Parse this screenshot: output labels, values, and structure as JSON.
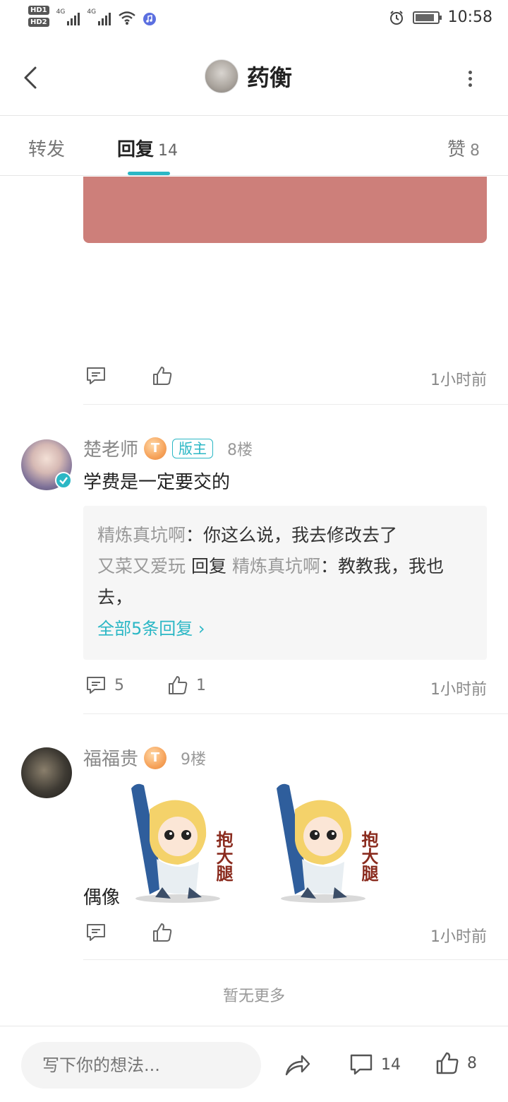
{
  "status_bar": {
    "hd1": "HD1",
    "hd2": "HD2",
    "net1": "4G",
    "net2": "4G",
    "time": "10:58",
    "battery_level": 0.85
  },
  "header": {
    "title": "药衡"
  },
  "tabs": {
    "forward": "转发",
    "reply": "回复",
    "reply_count": "14",
    "like": "赞",
    "like_count": "8"
  },
  "top_post": {
    "time": "1小时前"
  },
  "comments": [
    {
      "user": "楚老师",
      "level": "T",
      "mod_badge": "版主",
      "floor": "8楼",
      "text": "学费是一定要交的",
      "replies": [
        {
          "from": "精炼真坑啊",
          "sep": "：",
          "text": "你这么说，我去修改去了"
        },
        {
          "from": "又菜又爱玩",
          "verb": "回复",
          "to": "精炼真坑啊",
          "sep": "：",
          "text": "教教我，我也去，"
        }
      ],
      "more_replies": "全部5条回复 ›",
      "comment_count": "5",
      "like_count": "1",
      "time": "1小时前"
    },
    {
      "user": "福福贵",
      "level": "T",
      "floor": "9楼",
      "text": "偶像",
      "stickers": [
        "抱大腿",
        "抱大腿"
      ],
      "time": "1小时前"
    }
  ],
  "no_more": "暂无更多",
  "bottom_bar": {
    "placeholder": "写下你的想法...",
    "comment_count": "14",
    "like_count": "8"
  },
  "colors": {
    "accent": "#2bb7c5",
    "image_block": "#cd7f7a",
    "reply_bg": "#f6f6f6"
  }
}
